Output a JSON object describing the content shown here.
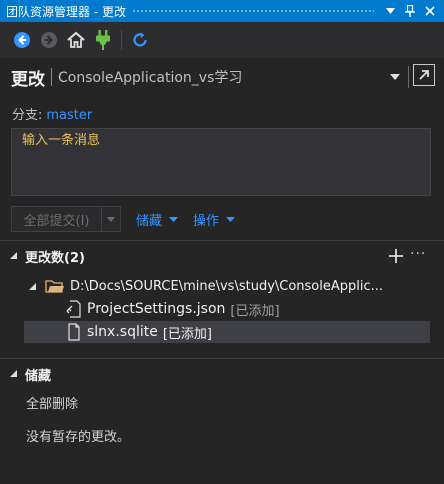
{
  "window": {
    "title": "团队资源管理器 - 更改",
    "dropdown_icon": "dropdown-arrow-icon",
    "pin_icon": "pin-icon",
    "close_icon": "close-icon"
  },
  "toolbar": {
    "items": [
      "back-icon",
      "forward-icon",
      "home-icon",
      "connect-icon",
      "refresh-icon"
    ]
  },
  "header": {
    "title": "更改",
    "project": "ConsoleApplication_vs学习"
  },
  "branch": {
    "label": "分支:",
    "name": "master"
  },
  "message": {
    "placeholder": "输入一条消息"
  },
  "actions": {
    "commit_all": "全部提交(I)",
    "stash": "储藏",
    "operations": "操作"
  },
  "changes": {
    "title": "更改数(2)",
    "folder": "D:\\Docs\\SOURCE\\mine\\vs\\study\\ConsoleApplic...",
    "files": [
      {
        "name": "ProjectSettings.json",
        "status": "[已添加]"
      },
      {
        "name": "slnx.sqlite",
        "status": "[已添加]"
      }
    ]
  },
  "stashes": {
    "title": "储藏",
    "delete_all": "全部删除",
    "empty_message": "没有暂存的更改。"
  },
  "colors": {
    "accent": "#007acc",
    "link": "#3794ff",
    "placeholder": "#e8c05a",
    "background": "#252526",
    "selection": "#3f3f46"
  }
}
